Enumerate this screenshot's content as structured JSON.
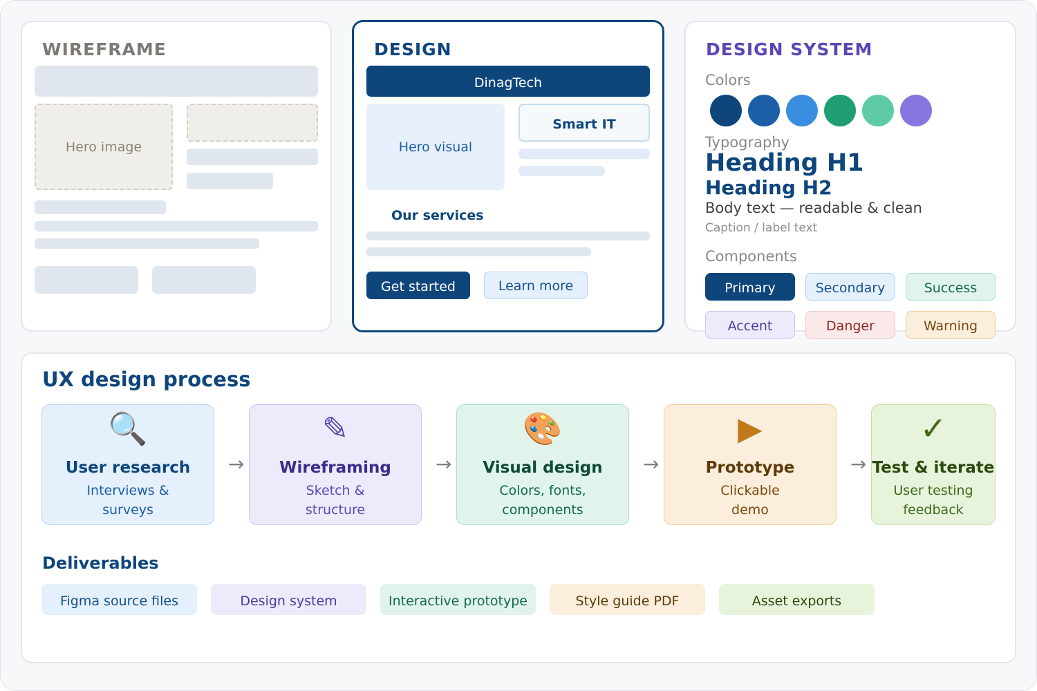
{
  "wireframe": {
    "title": "WIREFRAME",
    "hero_label": "Hero image"
  },
  "design": {
    "title": "DESIGN",
    "brand": "DinagTech",
    "hero_label": "Hero visual",
    "smart_label": "Smart IT",
    "services_label": "Our services",
    "primary_cta": "Get started",
    "secondary_cta": "Learn more"
  },
  "design_system": {
    "title": "DESIGN SYSTEM",
    "colors_label": "Colors",
    "colors": [
      "#0e467c",
      "#1b5fa6",
      "#3a8ee0",
      "#1e9e72",
      "#5ecba4",
      "#8577df"
    ],
    "typography_label": "Typography",
    "h1": "Heading H1",
    "h2": "Heading H2",
    "body": "Body text — readable & clean",
    "caption": "Caption / label text",
    "components_label": "Components",
    "components": [
      {
        "label": "Primary",
        "bg": "#0e467c",
        "fg": "#ffffff",
        "border": "#0e467c"
      },
      {
        "label": "Secondary",
        "bg": "#e4f0fb",
        "fg": "#15518f",
        "border": "#b6d3ee"
      },
      {
        "label": "Success",
        "bg": "#e0f4ec",
        "fg": "#15694c",
        "border": "#a9dfc8"
      },
      {
        "label": "Accent",
        "bg": "#ecebfb",
        "fg": "#4a3b9e",
        "border": "#cbc5f0"
      },
      {
        "label": "Danger",
        "bg": "#fbe9e9",
        "fg": "#8f2626",
        "border": "#f0c6c6"
      },
      {
        "label": "Warning",
        "bg": "#fbeedc",
        "fg": "#7a4a0c",
        "border": "#f1cd91"
      }
    ]
  },
  "process": {
    "title": "UX design process",
    "steps": [
      {
        "icon": "magnifier-icon",
        "glyph": "🔍",
        "title": "User research",
        "line1": "Interviews &",
        "line2": "surveys",
        "bg": "#e4f0fb",
        "border": "#b6d3ee",
        "title_color": "#0e467c",
        "text_color": "#1b5fa6",
        "icon_color": "#1b5fa6"
      },
      {
        "icon": "pencil-icon",
        "glyph": "✎",
        "title": "Wireframing",
        "line1": "Sketch &",
        "line2": "structure",
        "bg": "#ecebfb",
        "border": "#cbc5f0",
        "title_color": "#3b2d8a",
        "text_color": "#5a4bb0",
        "icon_color": "#5a4bb0"
      },
      {
        "icon": "palette-icon",
        "glyph": "🎨",
        "title": "Visual design",
        "line1": "Colors, fonts,",
        "line2": "components",
        "bg": "#e0f4ec",
        "border": "#a9dfc8",
        "title_color": "#0e4a36",
        "text_color": "#15694c",
        "icon_color": "#1e9e72"
      },
      {
        "icon": "play-icon",
        "glyph": "▶",
        "title": "Prototype",
        "line1": "Clickable",
        "line2": "demo",
        "bg": "#fbeedc",
        "border": "#f1cd91",
        "title_color": "#5e3a08",
        "text_color": "#7a4a0c",
        "icon_color": "#c07a1a"
      },
      {
        "icon": "checkmark-icon",
        "glyph": "✓",
        "title": "Test & iterate",
        "line1": "User testing",
        "line2": "feedback",
        "bg": "#e8f3dc",
        "border": "#c6e0a8",
        "title_color": "#2a4a0e",
        "text_color": "#3f6a1c",
        "icon_color": "#3f6a1c"
      }
    ],
    "arrow": "→"
  },
  "deliverables": {
    "title": "Deliverables",
    "items": [
      {
        "label": "Figma source files",
        "bg": "#e4f0fb",
        "fg": "#15518f"
      },
      {
        "label": "Design system",
        "bg": "#ecebfb",
        "fg": "#4a3b9e"
      },
      {
        "label": "Interactive prototype",
        "bg": "#e0f4ec",
        "fg": "#15694c"
      },
      {
        "label": "Style guide PDF",
        "bg": "#fbeedc",
        "fg": "#5e3a08"
      },
      {
        "label": "Asset exports",
        "bg": "#e8f3dc",
        "fg": "#2a4a0e"
      }
    ]
  }
}
